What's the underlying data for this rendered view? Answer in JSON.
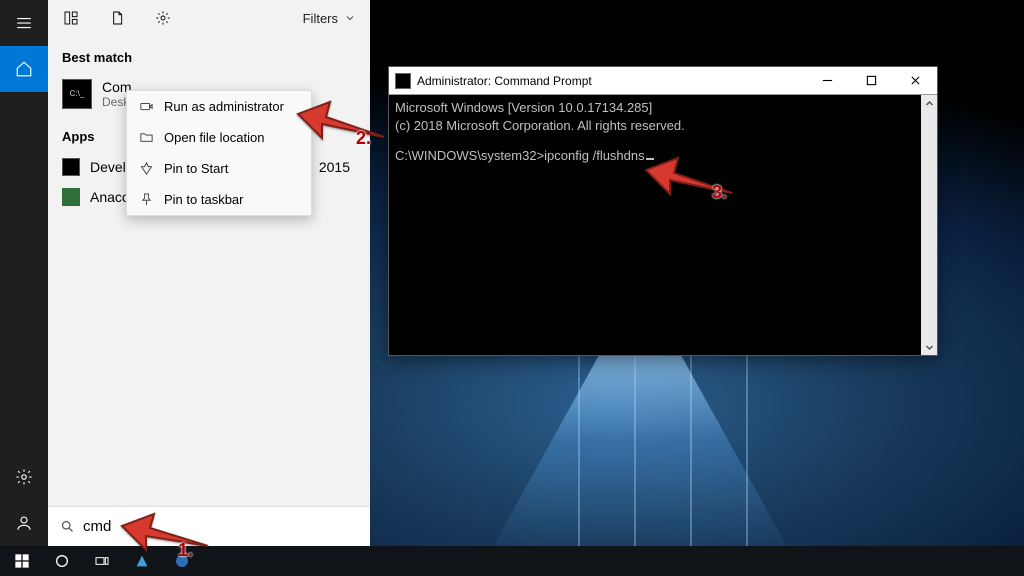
{
  "sidebar": {
    "items": [
      "menu",
      "home",
      "settings",
      "profile"
    ]
  },
  "search": {
    "filters_label": "Filters",
    "best_match_label": "Best match",
    "best_match": {
      "title_visible": "Com",
      "subtitle_visible": "Deskt"
    },
    "apps_label": "Apps",
    "apps": [
      {
        "name_visible": "Develo",
        "year": "2015"
      },
      {
        "name_visible": "Anacon"
      }
    ],
    "query": "cmd"
  },
  "context_menu": {
    "items": [
      {
        "label": "Run as administrator",
        "icon": "shield"
      },
      {
        "label": "Open file location",
        "icon": "folder"
      },
      {
        "label": "Pin to Start",
        "icon": "pin"
      },
      {
        "label": "Pin to taskbar",
        "icon": "pin-task"
      }
    ]
  },
  "cmd": {
    "title": "Administrator: Command Prompt",
    "lines": {
      "l1": "Microsoft Windows [Version 10.0.17134.285]",
      "l2": "(c) 2018 Microsoft Corporation. All rights reserved.",
      "prompt": "C:\\WINDOWS\\system32>",
      "input": "ipconfig /flushdns"
    }
  },
  "callouts": {
    "s1": "1.",
    "s2": "2.",
    "s3": "3."
  }
}
